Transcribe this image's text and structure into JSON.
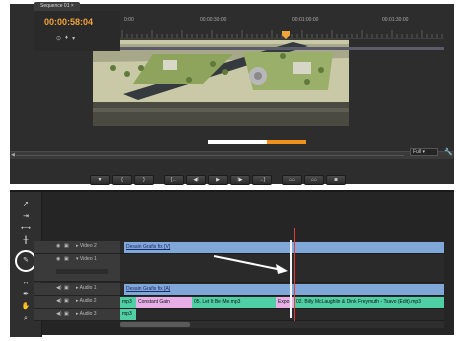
{
  "monitor": {
    "render_progress": 0.6,
    "fit_label": "Full",
    "transport_buttons": [
      {
        "icon": "mark-in-icon",
        "glyph": "▼"
      },
      {
        "icon": "mark-out-icon",
        "glyph": "{"
      },
      {
        "icon": "go-to-in-icon",
        "glyph": "}"
      },
      {
        "icon": "step-back-icon",
        "glyph": "{←"
      },
      {
        "icon": "play-back-icon",
        "glyph": "◀I"
      },
      {
        "icon": "play-icon",
        "glyph": "▶"
      },
      {
        "icon": "step-forward-icon",
        "glyph": "I▶"
      },
      {
        "icon": "go-to-out-icon",
        "glyph": "→}"
      },
      {
        "icon": "lift-icon",
        "glyph": "⌂⌂"
      },
      {
        "icon": "extract-icon",
        "glyph": "⌂⌂"
      },
      {
        "icon": "export-frame-icon",
        "glyph": "◙"
      }
    ]
  },
  "timeline": {
    "tab": "Sequence 01",
    "timecode": "00:00:58:04",
    "ruler": [
      "0:00",
      "00:00:30:00",
      "00:01:00:00",
      "00:01:30:00"
    ],
    "tracks": {
      "video2": "Video 2",
      "video1": "Video 1",
      "audio1": "Audio 1",
      "audio2": "Audio 2",
      "audio3": "Audio 3"
    },
    "clips": {
      "v1": "Desain Grafis fix [V]",
      "a1": "Desain Grafis fix [A]",
      "a2_1": "mp3",
      "a2_2": "Constant Gain",
      "a2_3": "05. Let It Be Me.mp3",
      "a2_4": "Expo",
      "a2_5": "02. Billy McLaughlin & Dink Freymuth - Tsavo (Edit).mp3",
      "a3": "mp3"
    }
  },
  "colors": {
    "timecode": "#f2a33a",
    "video_clip": "#7fa8d8",
    "audio_clip": "#4fcfa4",
    "audio_clip_alt": "#e8aee8"
  }
}
